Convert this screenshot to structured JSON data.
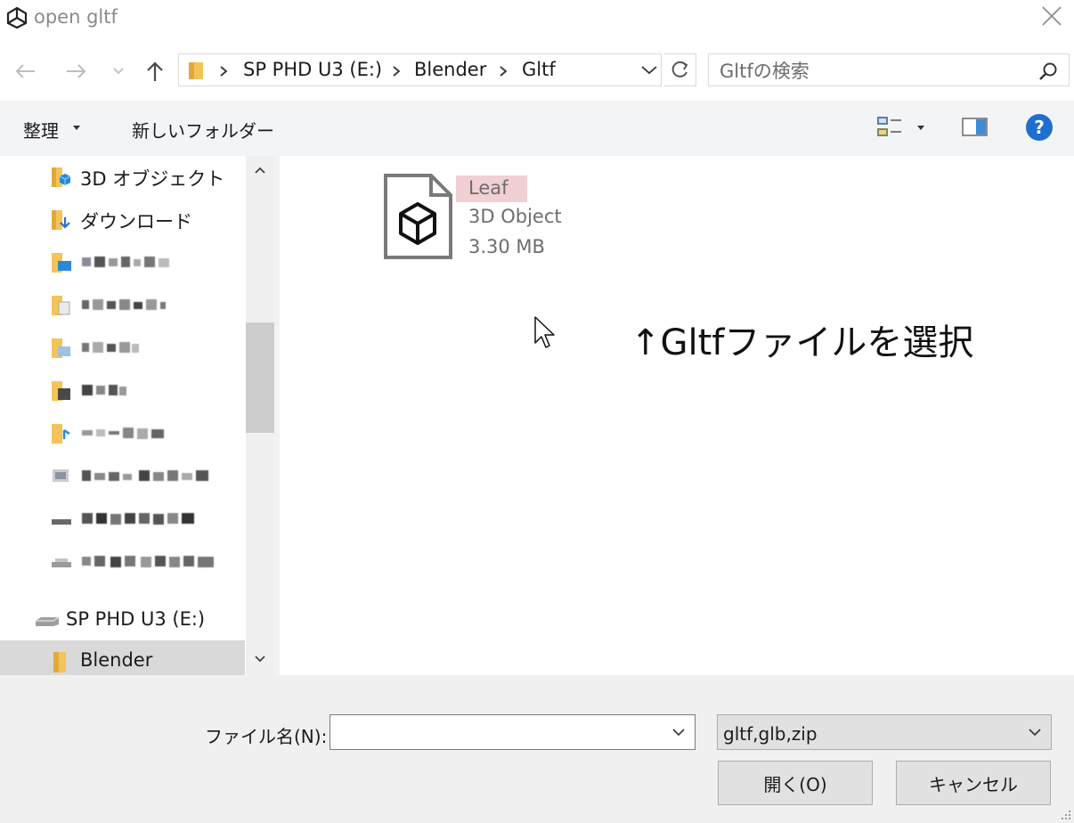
{
  "window": {
    "title": "open gltf",
    "app_icon": "unity-logo-icon",
    "close_icon": "close-icon"
  },
  "nav": {
    "back_icon": "arrow-left-icon",
    "forward_icon": "arrow-right-icon",
    "recent_icon": "chevron-down-icon",
    "up_icon": "arrow-up-icon"
  },
  "address": {
    "breadcrumbs": [
      "SP PHD U3 (E:)",
      "Blender",
      "Gltf"
    ],
    "refresh_icon": "refresh-icon"
  },
  "search": {
    "placeholder": "Gltfの検索",
    "icon": "search-icon"
  },
  "toolbar": {
    "organize": "整理",
    "new_folder": "新しいフォルダー",
    "view_icon": "view-options-icon",
    "preview_icon": "preview-pane-icon",
    "help_icon": "help-icon"
  },
  "sidebar": {
    "items": [
      {
        "label": "3D オブジェクト",
        "icon": "3d-objects-folder-icon"
      },
      {
        "label": "ダウンロード",
        "icon": "downloads-folder-icon"
      },
      {
        "label": "",
        "icon": "desktop-folder-icon"
      },
      {
        "label": "",
        "icon": "documents-folder-icon"
      },
      {
        "label": "",
        "icon": "pictures-folder-icon"
      },
      {
        "label": "",
        "icon": "videos-folder-icon"
      },
      {
        "label": "",
        "icon": "music-folder-icon"
      },
      {
        "label": "",
        "icon": "network-drive-icon"
      },
      {
        "label": "",
        "icon": "drive-icon"
      },
      {
        "label": "",
        "icon": "drive-icon"
      },
      {
        "label": "SP PHD U3 (E:)",
        "icon": "external-drive-icon"
      },
      {
        "label": "Blender",
        "icon": "folder-icon"
      }
    ],
    "selected_index": 11
  },
  "files": [
    {
      "name": "Leaf",
      "type": "3D Object",
      "size": "3.30 MB",
      "icon": "3d-object-file-icon"
    }
  ],
  "annotation": "↑Gltfファイルを選択",
  "footer": {
    "filename_label": "ファイル名(N):",
    "filename_value": "",
    "filter_value": "gltf,glb,zip",
    "open_button": "開く(O)",
    "cancel_button": "キャンセル"
  },
  "colors": {
    "selected_bg": "#d9d9d9",
    "toolbar_bg": "#f3f4f6",
    "highlight": "#f0d0d3",
    "help_blue": "#1e6fcf"
  }
}
